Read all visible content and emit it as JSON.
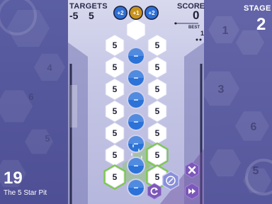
{
  "targets": {
    "label": "TARGETS",
    "negative": "-5",
    "positive": "5"
  },
  "score": {
    "label": "SCORE",
    "value": "0",
    "best_label": "BEST",
    "best_value": "1"
  },
  "stage": {
    "label": "STAGE",
    "number": "2"
  },
  "level": {
    "number": "19",
    "name": "The 5 Star Pit"
  },
  "bonus_tokens": [
    {
      "label": "+2",
      "color": "#2e6fd6"
    },
    {
      "label": "+1",
      "color": "#c8921b"
    },
    {
      "label": "+2",
      "color": "#2e6fd6"
    }
  ],
  "board": {
    "rows": [
      {
        "top": "",
        "left": "5",
        "center": "−",
        "right": "5"
      },
      {
        "left": "5",
        "center": "−",
        "right": "5"
      },
      {
        "left": "5",
        "center": "−",
        "right": "5"
      },
      {
        "left": "5",
        "center": "−",
        "right": "5"
      },
      {
        "left": "5",
        "center": "−",
        "right": "5"
      },
      {
        "left": "5",
        "center": "−",
        "right": "5"
      },
      {
        "left": "5",
        "center": "−",
        "right": "5"
      }
    ],
    "highlight_color": "#7ac943"
  },
  "controls": [
    {
      "icon": "shield-icon"
    },
    {
      "icon": "close-icon"
    },
    {
      "icon": "refresh-icon"
    },
    {
      "icon": "fast-forward-icon"
    }
  ],
  "background_numbers": {
    "left": [
      "4",
      "6",
      "5"
    ],
    "right": [
      "1",
      "3",
      "6",
      "5"
    ]
  },
  "colors": {
    "bg": "#5e5f9e",
    "hex_white": "#ffffff",
    "hex_blue": "#2b72d9",
    "board_bg": "#c7c8e6"
  }
}
